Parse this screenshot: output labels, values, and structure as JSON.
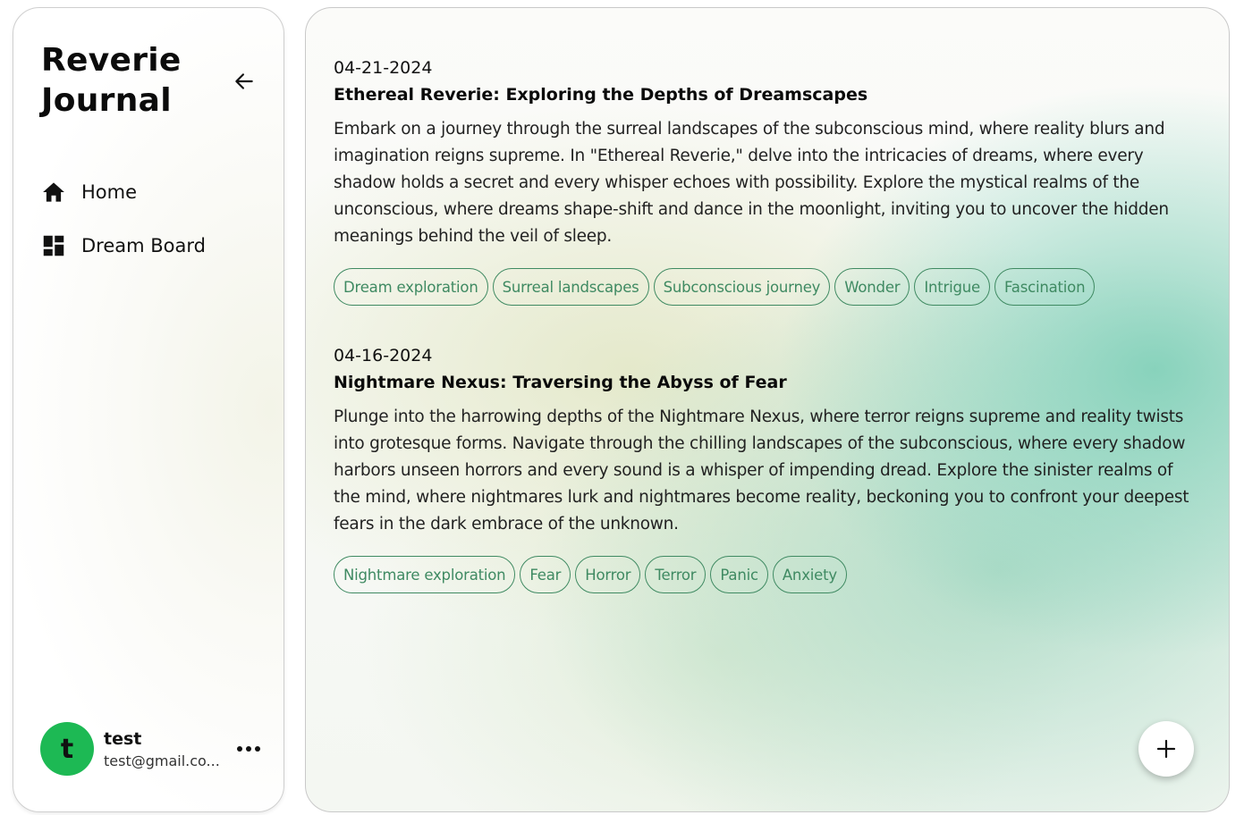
{
  "sidebar": {
    "brand": "Reverie\nJournal",
    "nav": [
      {
        "label": "Home",
        "icon": "home-icon"
      },
      {
        "label": "Dream Board",
        "icon": "dashboard-icon"
      }
    ],
    "user": {
      "avatar_letter": "t",
      "name": "test",
      "email": "test@gmail.co...",
      "avatar_color": "#1db954"
    }
  },
  "entries": [
    {
      "date": "04-21-2024",
      "title": "Ethereal Reverie: Exploring the Depths of Dreamscapes",
      "body": "Embark on a journey through the surreal landscapes of the subconscious mind, where reality blurs and imagination reigns supreme. In \"Ethereal Reverie,\" delve into the intricacies of dreams, where every shadow holds a secret and every whisper echoes with possibility. Explore the mystical realms of the unconscious, where dreams shape-shift and dance in the moonlight, inviting you to uncover the hidden meanings behind the veil of sleep.",
      "tags": [
        "Dream exploration",
        "Surreal landscapes",
        "Subconscious journey",
        "Wonder",
        "Intrigue",
        "Fascination"
      ]
    },
    {
      "date": "04-16-2024",
      "title": "Nightmare Nexus: Traversing the Abyss of Fear",
      "body": "Plunge into the harrowing depths of the Nightmare Nexus, where terror reigns supreme and reality twists into grotesque forms. Navigate through the chilling landscapes of the subconscious, where every shadow harbors unseen horrors and every sound is a whisper of impending dread. Explore the sinister realms of the mind, where nightmares lurk and nightmares become reality, beckoning you to confront your deepest fears in the dark embrace of the unknown.",
      "tags": [
        "Nightmare exploration",
        "Fear",
        "Horror",
        "Terror",
        "Panic",
        "Anxiety"
      ]
    }
  ],
  "colors": {
    "accent": "#3f8a62",
    "avatar": "#1db954"
  }
}
